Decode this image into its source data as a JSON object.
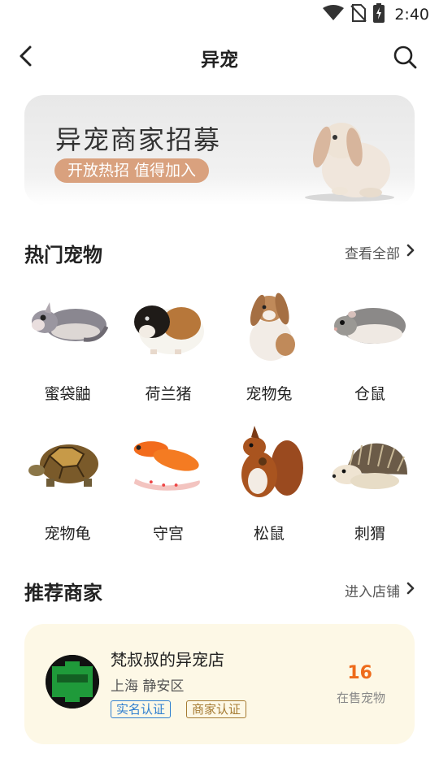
{
  "status_bar": {
    "time": "2:40",
    "icons": [
      "wifi-icon",
      "no-sim-icon",
      "battery-charging-icon"
    ]
  },
  "header": {
    "title": "异宠",
    "back_icon": "back-arrow-icon",
    "search_icon": "search-icon"
  },
  "banner": {
    "title": "异宠商家招募",
    "tag": "开放热招 值得加入"
  },
  "hot_pets": {
    "title": "热门宠物",
    "more_label": "查看全部",
    "items": [
      {
        "name": "蜜袋鼬"
      },
      {
        "name": "荷兰猪"
      },
      {
        "name": "宠物兔"
      },
      {
        "name": "仓鼠"
      },
      {
        "name": "宠物龟"
      },
      {
        "name": "守宫"
      },
      {
        "name": "松鼠"
      },
      {
        "name": "刺猬"
      }
    ]
  },
  "merchants": {
    "title": "推荐商家",
    "more_label": "进入店铺",
    "shop": {
      "name": "梵叔叔的异宠店",
      "location": "上海 静安区",
      "badges": [
        "实名认证",
        "商家认证"
      ],
      "count": "16",
      "count_label": "在售宠物"
    }
  },
  "colors": {
    "accent_orange": "#ee6b1b",
    "tag_brown": "#d9a17e",
    "card_bg": "#fdf8e6",
    "badge_blue": "#2f7fd0",
    "badge_gold": "#a57a31"
  }
}
